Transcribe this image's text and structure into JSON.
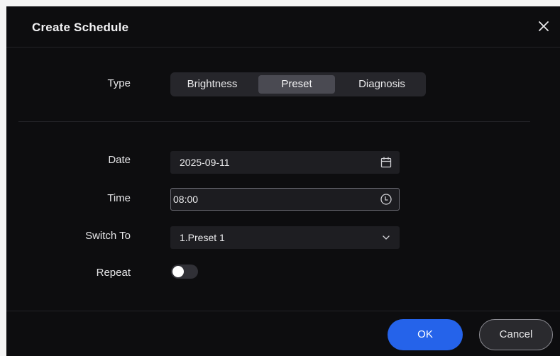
{
  "dialog": {
    "title": "Create Schedule",
    "close_icon": "close-icon"
  },
  "type": {
    "label": "Type",
    "options": [
      "Brightness",
      "Preset",
      "Diagnosis"
    ],
    "selected": "Preset"
  },
  "date": {
    "label": "Date",
    "value": "2025-09-11",
    "icon": "calendar-icon"
  },
  "time": {
    "label": "Time",
    "value": "08:00",
    "icon": "clock-icon"
  },
  "switch_to": {
    "label": "Switch To",
    "value": "1.Preset 1",
    "icon": "chevron-down-icon"
  },
  "repeat": {
    "label": "Repeat",
    "enabled": false
  },
  "footer": {
    "ok_label": "OK",
    "cancel_label": "Cancel"
  },
  "colors": {
    "background": "#0d0d0f",
    "primary": "#2563ea",
    "segment_active": "#4a4a52"
  }
}
